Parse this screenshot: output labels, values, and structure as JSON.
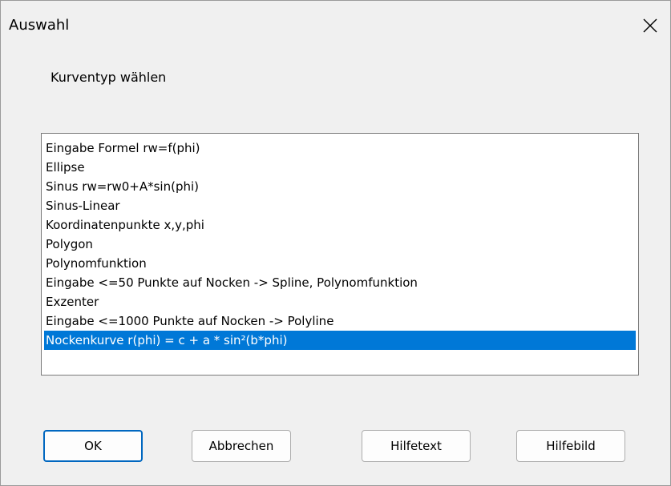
{
  "dialog": {
    "title": "Auswahl",
    "prompt": "Kurventyp wählen",
    "close_icon": "close-icon"
  },
  "list": {
    "items": [
      "Eingabe Formel rw=f(phi)",
      "Ellipse",
      "Sinus rw=rw0+A*sin(phi)",
      "Sinus-Linear",
      "Koordinatenpunkte x,y,phi",
      "Polygon",
      "Polynomfunktion",
      "Eingabe <=50 Punkte auf Nocken -> Spline, Polynomfunktion",
      "Exzenter",
      "Eingabe <=1000 Punkte auf Nocken -> Polyline",
      "Nockenkurve r(phi) = c + a * sin²(b*phi)"
    ],
    "selected_index": 10
  },
  "buttons": {
    "ok": "OK",
    "cancel": "Abbrechen",
    "help_text": "Hilfetext",
    "help_image": "Hilfebild"
  },
  "colors": {
    "selection": "#0078d7",
    "default_button_border": "#0067c0",
    "background": "#f0f0f0"
  }
}
